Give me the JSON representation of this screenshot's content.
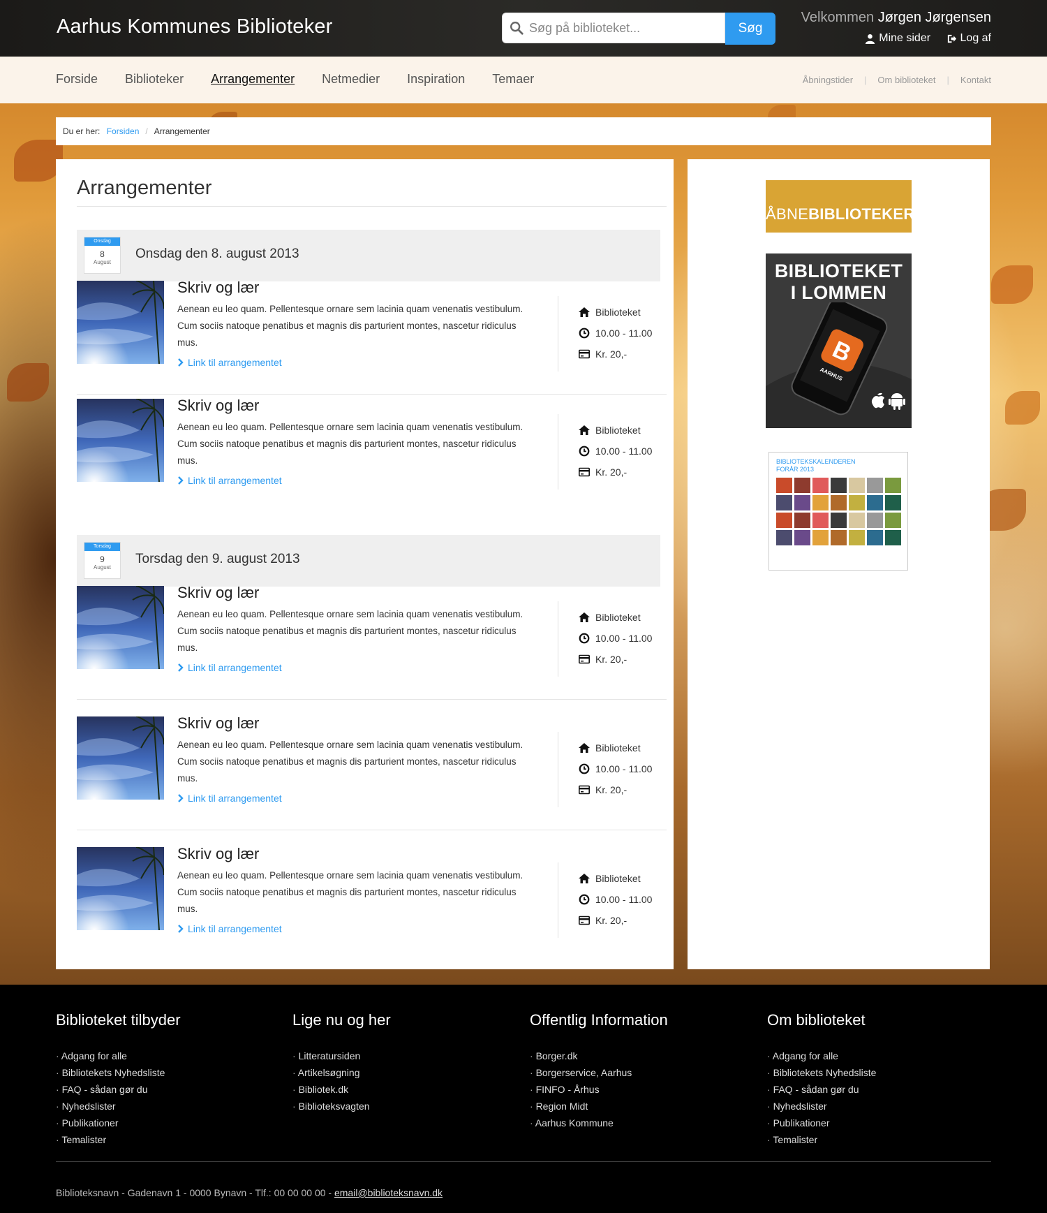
{
  "header": {
    "site_title": "Aarhus Kommunes Biblioteker",
    "search_placeholder": "Søg på biblioteket...",
    "search_button": "Søg",
    "welcome_prefix": "Velkommen",
    "user_name": "Jørgen Jørgensen",
    "my_pages": "Mine sider",
    "logout": "Log af"
  },
  "nav": {
    "main": [
      "Forside",
      "Biblioteker",
      "Arrangementer",
      "Netmedier",
      "Inspiration",
      "Temaer"
    ],
    "active": "Arrangementer",
    "secondary": [
      "Åbningstider",
      "Om biblioteket",
      "Kontakt"
    ]
  },
  "breadcrumb": {
    "prefix": "Du er her:",
    "home": "Forsiden",
    "current": "Arrangementer"
  },
  "main": {
    "title": "Arrangementer",
    "days": [
      {
        "weekday_short": "Onsdag",
        "day": "8",
        "month": "August",
        "title": "Onsdag den 8. august 2013"
      },
      {
        "weekday_short": "Torsdag",
        "day": "9",
        "month": "August",
        "title": "Torsdag den 9. august 2013"
      }
    ],
    "event": {
      "title": "Skriv og lær",
      "description": "Aenean eu leo quam. Pellentesque ornare sem lacinia quam venenatis vestibulum. Cum sociis natoque penatibus et magnis dis parturient montes, nascetur ridiculus mus.",
      "link": "Link til arrangementet",
      "location": "Biblioteket",
      "time": "10.00 - 11.00",
      "price": "Kr. 20,-"
    }
  },
  "sidebar": {
    "ad_open_prefix": "ÅBNE",
    "ad_open_bold": "BIBLIOTEKER",
    "ad_app_title_1": "BIBLIOTEKET",
    "ad_app_title_2": "I LOMMEN",
    "ad_app_logo": "B",
    "ad_app_logo_sub": "AARHUS",
    "ad_cal_title_1": "BIBLIOTEKSKALENDEREN",
    "ad_cal_title_2": "FORÅR 2013"
  },
  "footer": {
    "columns": [
      {
        "title": "Biblioteket tilbyder",
        "items": [
          "Adgang for alle",
          "Bibliotekets Nyhedsliste",
          "FAQ - sådan gør du",
          "Nyhedslister",
          "Publikationer",
          "Temalister"
        ]
      },
      {
        "title": "Lige nu og her",
        "items": [
          "Litteratursiden",
          "Artikelsøgning",
          "Bibliotek.dk",
          "Biblioteksvagten"
        ]
      },
      {
        "title": "Offentlig Information",
        "items": [
          "Borger.dk",
          "Borgerservice, Aarhus",
          "FINFO - Århus",
          "Region Midt",
          "Aarhus Kommune"
        ]
      },
      {
        "title": "Om biblioteket",
        "items": [
          "Adgang for alle",
          "Bibliotekets Nyhedsliste",
          "FAQ - sådan gør du",
          "Nyhedslister",
          "Publikationer",
          "Temalister"
        ]
      }
    ],
    "address": "Biblioteksnavn - Gadenavn 1 - 0000 Bynavn - Tlf.: 00 00 00 00 - ",
    "email": "email@biblioteksnavn.dk"
  },
  "colors": {
    "accent": "#2f9bf0",
    "topbar": "#1f1e1c",
    "footer": "#000000",
    "ad_gold": "#d9a434"
  },
  "icons": [
    "search-icon",
    "user-icon",
    "logout-icon",
    "chevron-right-icon",
    "home-icon",
    "clock-icon",
    "credit-card-icon",
    "apple-icon",
    "android-icon"
  ]
}
